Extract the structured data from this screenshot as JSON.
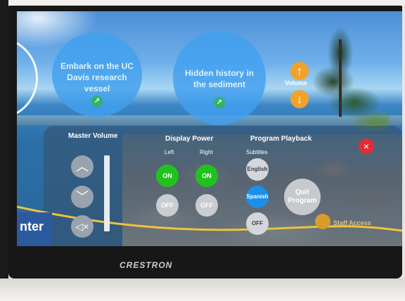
{
  "bubbles": [
    {
      "text": "Embark on the UC Davis research vessel",
      "icon": "arrow-up-right-icon"
    },
    {
      "text": "Hidden history in the sediment",
      "icon": "arrow-up-right-icon"
    }
  ],
  "volume_quick": {
    "label": "Volume",
    "up_icon": "arrow-up-icon",
    "down_icon": "arrow-down-icon"
  },
  "panel": {
    "master_volume": {
      "title": "Master Volume",
      "up_icon": "chevron-up-icon",
      "down_icon": "chevron-down-icon",
      "mute_icon": "speaker-mute-icon"
    },
    "display_power": {
      "title": "Display Power",
      "left_label": "Left",
      "right_label": "Right",
      "on_label": "ON",
      "off_label": "OFF"
    },
    "program_playback": {
      "title": "Program Playback",
      "subtitles_label": "Subtitles",
      "options": [
        "English",
        "Spanish",
        "OFF"
      ],
      "selected": "Spanish",
      "quit_label": "Quit\nProgram"
    },
    "staff_access": "Staff Access",
    "close_icon": "close-x-icon"
  },
  "logo_text": "nter",
  "brand": "CRESTRON",
  "colors": {
    "on": "#21c21e",
    "selected": "#1c8fe8",
    "accent": "#f0a22a",
    "close": "#e12d34"
  }
}
